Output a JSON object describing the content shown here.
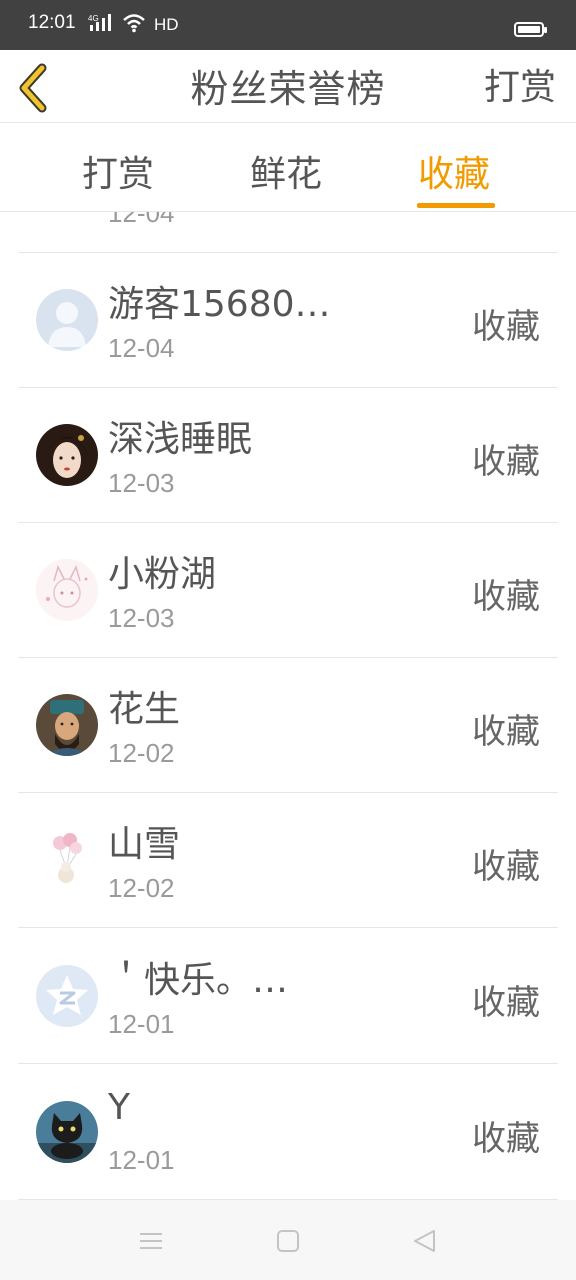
{
  "status_bar": {
    "time": "12:01",
    "network": "4G",
    "hd": "HD"
  },
  "header": {
    "title": "粉丝荣誉榜",
    "action_label": "打赏",
    "back_icon": "chevron-left-icon",
    "accent_color": "#f29b00"
  },
  "tabs": [
    {
      "label": "打赏",
      "active": false
    },
    {
      "label": "鲜花",
      "active": false
    },
    {
      "label": "收藏",
      "active": true
    }
  ],
  "list": {
    "partial_top": {
      "date": "12-04"
    },
    "items": [
      {
        "name": "游客15680…",
        "date": "12-04",
        "action": "收藏",
        "avatar": "default-user-avatar"
      },
      {
        "name": "深浅睡眠",
        "date": "12-03",
        "action": "收藏",
        "avatar": "portrait-avatar"
      },
      {
        "name": "小粉湖",
        "date": "12-03",
        "action": "收藏",
        "avatar": "anime-cat-avatar"
      },
      {
        "name": "花生",
        "date": "12-02",
        "action": "收藏",
        "avatar": "warrior-avatar"
      },
      {
        "name": "山雪",
        "date": "12-02",
        "action": "收藏",
        "avatar": "balloon-avatar"
      },
      {
        "name": "＇快乐。…",
        "date": "12-01",
        "action": "收藏",
        "avatar": "qzone-avatar"
      },
      {
        "name": "Y",
        "date": "12-01",
        "action": "收藏",
        "avatar": "black-cat-avatar"
      }
    ]
  },
  "nav_bar": {
    "buttons": [
      "menu-icon",
      "home-square-icon",
      "back-triangle-icon"
    ]
  }
}
